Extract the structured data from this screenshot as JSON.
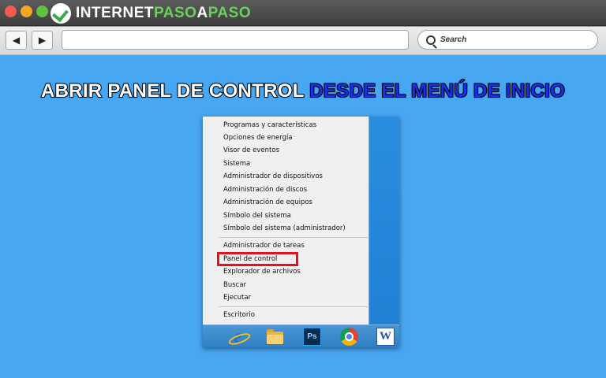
{
  "browser": {
    "logo": {
      "prefix": "INTERNET",
      "highlight": "PASO",
      "mid": "A",
      "suffix": "PASO"
    },
    "nav": {
      "back_icon": "◀",
      "forward_icon": "▶"
    },
    "search": {
      "placeholder": "Search"
    }
  },
  "heading": {
    "white_part": "ABRIR PANEL DE CONTROL",
    "blue_part": "DESDE EL MENÚ DE INICIO"
  },
  "winx_menu": {
    "group1": [
      "Programas y características",
      "Opciones de energía",
      "Visor de eventos",
      "Sistema",
      "Administrador de dispositivos",
      "Administración de discos",
      "Administración de equipos",
      "Símbolo del sistema",
      "Símbolo del sistema (administrador)"
    ],
    "group2": [
      "Administrador de tareas",
      "Panel de control",
      "Explorador de archivos",
      "Buscar",
      "Ejecutar"
    ],
    "group3": [
      "Escritorio"
    ]
  },
  "taskbar": {
    "ie_label": "e",
    "ps_label": "Ps",
    "word_label": "W"
  },
  "colors": {
    "background": "#47a7f3",
    "highlight_box": "#e0141e",
    "heading_blue": "#1a2ee8"
  }
}
